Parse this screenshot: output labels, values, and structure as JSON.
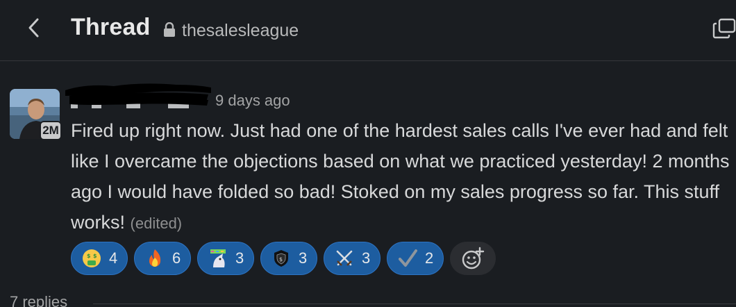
{
  "header": {
    "title": "Thread",
    "channel": "thesalesleague",
    "back_icon": "chevron-left-icon",
    "lock_icon": "lock-icon",
    "expand_icon": "open-in-window-icon"
  },
  "message": {
    "author_redacted": true,
    "avatar_badge": "2M",
    "timestamp": "9 days ago",
    "text": "Fired up right now. Just had one of the hardest sales calls I've ever had and felt like I overcame the objections based on what we practiced yesterday! 2 months ago I would have folded so bad! Stoked on my sales progress so far. This stuff works!",
    "edited_label": "(edited)"
  },
  "reactions": [
    {
      "emoji": "money-mouth-face",
      "count": "4"
    },
    {
      "emoji": "fire",
      "count": "6"
    },
    {
      "emoji": "unicorn-money",
      "count": "3"
    },
    {
      "emoji": "shield-badge",
      "count": "3"
    },
    {
      "emoji": "crossed-swords",
      "count": "3"
    },
    {
      "emoji": "check-mark",
      "count": "2"
    }
  ],
  "add_reaction_icon": "add-emoji-icon",
  "replies": {
    "label": "7 replies"
  },
  "colors": {
    "background": "#1a1d21",
    "reaction_bg": "#1d5da0",
    "reaction_border": "#2d74c4",
    "text": "#d8d9da",
    "muted": "#a3a4a5"
  }
}
